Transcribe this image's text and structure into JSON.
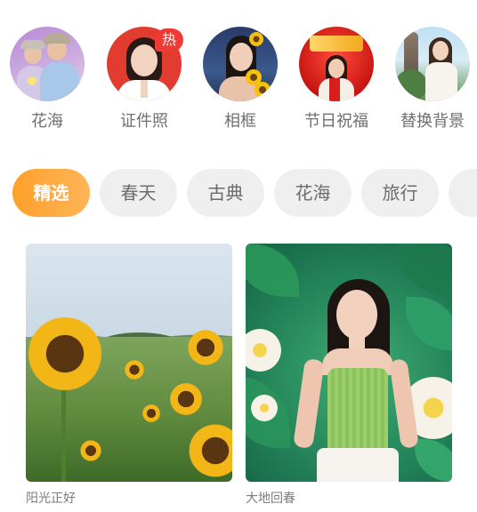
{
  "categories": [
    {
      "label": "花海",
      "icon": "couple-photo-avatar"
    },
    {
      "label": "证件照",
      "icon": "id-photo-avatar",
      "badge": "热"
    },
    {
      "label": "相框",
      "icon": "frame-photo-avatar"
    },
    {
      "label": "节日祝福",
      "icon": "festival-greeting-avatar"
    },
    {
      "label": "替换背景",
      "icon": "replace-background-avatar"
    }
  ],
  "tabs": [
    {
      "label": "精选",
      "active": true
    },
    {
      "label": "春天",
      "active": false
    },
    {
      "label": "古典",
      "active": false
    },
    {
      "label": "花海",
      "active": false
    },
    {
      "label": "旅行",
      "active": false
    }
  ],
  "templates": [
    {
      "title": "阳光正好",
      "image": "sunflower-field"
    },
    {
      "title": "大地回春",
      "image": "woman-green-leaf-background"
    }
  ],
  "colors": {
    "accent": "#ffa02a",
    "badge": "#ef3b36",
    "chip_bg": "#efefef",
    "label_text": "#6f6f6f"
  }
}
